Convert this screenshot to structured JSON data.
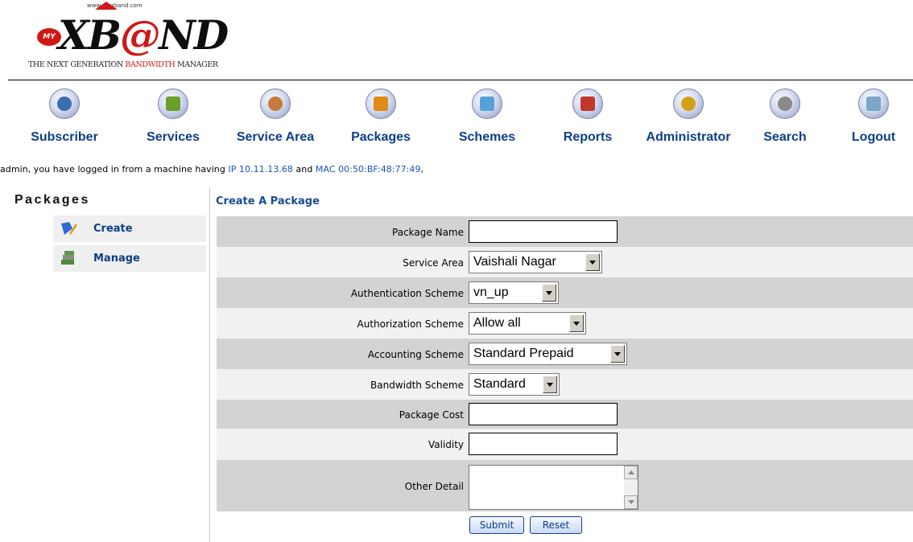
{
  "logo": {
    "url": "www.myxband.com",
    "my": "MY",
    "mark_left": "XB",
    "mark_at": "@",
    "mark_right": "ND",
    "tagline_a": "THE NEXT GENERATION ",
    "tagline_b": "BANDWIDTH",
    "tagline_c": " MANAGER"
  },
  "nav": [
    {
      "label": "Subscriber",
      "icon": "subscriber-icon",
      "color": "#3a6fb0"
    },
    {
      "label": "Services",
      "icon": "services-icon",
      "color": "#6a9f2a"
    },
    {
      "label": "Service Area",
      "icon": "service-area-icon",
      "color": "#c77b3a"
    },
    {
      "label": "Packages",
      "icon": "packages-icon",
      "color": "#e08a18"
    },
    {
      "label": "Schemes",
      "icon": "schemes-icon",
      "color": "#5aa0d8"
    },
    {
      "label": "Reports",
      "icon": "reports-icon",
      "color": "#c0392b"
    },
    {
      "label": "Administrator",
      "icon": "administrator-icon",
      "color": "#d4a017"
    },
    {
      "label": "Search",
      "icon": "search-icon",
      "color": "#8a8a8a"
    },
    {
      "label": "Logout",
      "icon": "logout-icon",
      "color": "#7aa6c8"
    }
  ],
  "info": {
    "prefix": "admin, you have logged in from a machine having ",
    "ip": "IP 10.11.13.68",
    "and": " and ",
    "mac": "MAC 00:50:BF:48:77:49",
    "suffix": ","
  },
  "sidebar": {
    "title": "Packages",
    "items": [
      {
        "label": "Create",
        "icon": "create-icon"
      },
      {
        "label": "Manage",
        "icon": "manage-icon"
      }
    ]
  },
  "form": {
    "title": "Create A Package",
    "package_name": {
      "label": "Package Name",
      "value": ""
    },
    "service_area": {
      "label": "Service Area",
      "value": "Vaishali Nagar"
    },
    "auth_scheme": {
      "label": "Authentication Scheme",
      "value": "vn_up"
    },
    "authz_scheme": {
      "label": "Authorization Scheme",
      "value": "Allow all"
    },
    "acct_scheme": {
      "label": "Accounting Scheme",
      "value": "Standard Prepaid"
    },
    "bw_scheme": {
      "label": "Bandwidth Scheme",
      "value": "Standard"
    },
    "package_cost": {
      "label": "Package Cost",
      "value": ""
    },
    "validity": {
      "label": "Validity",
      "value": ""
    },
    "other_detail": {
      "label": "Other Detail",
      "value": ""
    },
    "submit": "Submit",
    "reset": "Reset"
  },
  "colors": {
    "link": "#0d3f86",
    "row_dark": "#d3d3d3",
    "row_light": "#f1f1f1",
    "logo_red": "#d11616"
  }
}
